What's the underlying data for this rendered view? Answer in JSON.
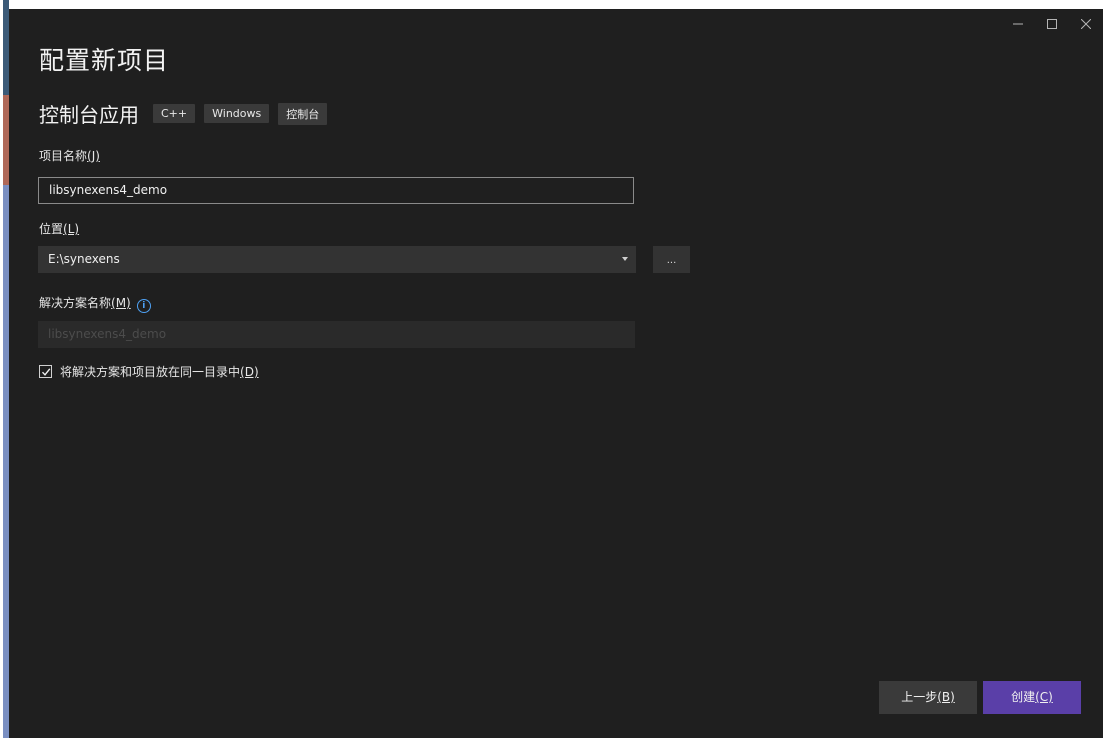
{
  "window": {
    "controls": {
      "minimize": "—",
      "maximize": "☐",
      "close": "✕"
    }
  },
  "header": {
    "title": "配置新项目",
    "subtitle": "控制台应用",
    "tags": [
      "C++",
      "Windows",
      "控制台"
    ]
  },
  "form": {
    "project_name": {
      "label": "项目名称",
      "accelerator": "(J)",
      "value": "libsynexens4_demo"
    },
    "location": {
      "label": "位置",
      "accelerator": "(L)",
      "value": "E:\\synexens",
      "browse_label": "..."
    },
    "solution_name": {
      "label": "解决方案名称",
      "accelerator": "(M)",
      "info_icon": "i",
      "value": "libsynexens4_demo"
    },
    "same_directory": {
      "label": "将解决方案和项目放在同一目录中",
      "accelerator": "(D)",
      "checked": true
    }
  },
  "footer": {
    "back_label": "上一步",
    "back_accelerator": "(B)",
    "create_label": "创建",
    "create_accelerator": "(C)"
  },
  "colors": {
    "background": "#1f1f1f",
    "primary_button": "#5a3fa8",
    "info_icon": "#4ea1f3"
  }
}
